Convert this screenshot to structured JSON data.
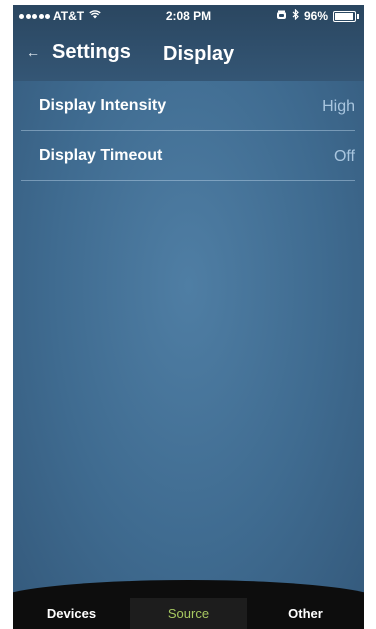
{
  "status_bar": {
    "carrier": "AT&T",
    "time": "2:08 PM",
    "battery": "96%",
    "battery_level": 0.96,
    "icons": [
      "signal-dots-icon",
      "wifi-icon",
      "alarm-icon",
      "bluetooth-icon",
      "battery-icon"
    ]
  },
  "nav": {
    "back_icon": "back-arrow-icon",
    "back_label": "Settings",
    "title": "Display"
  },
  "rows": [
    {
      "label": "Display Intensity",
      "value": "High"
    },
    {
      "label": "Display Timeout",
      "value": "Off"
    }
  ],
  "tabbar": {
    "tabs": [
      {
        "label": "Devices"
      },
      {
        "label": "Source"
      },
      {
        "label": "Other"
      }
    ],
    "active_tab": "Source"
  },
  "colors": {
    "nav_background": "#2f4f6d",
    "content_background": "#4a789e",
    "row_value": "#a9c6df",
    "tabbar_background": "#0d0d0d",
    "active_tab_background": "#1d1d1d",
    "active_tab_text": "#a6c860"
  }
}
